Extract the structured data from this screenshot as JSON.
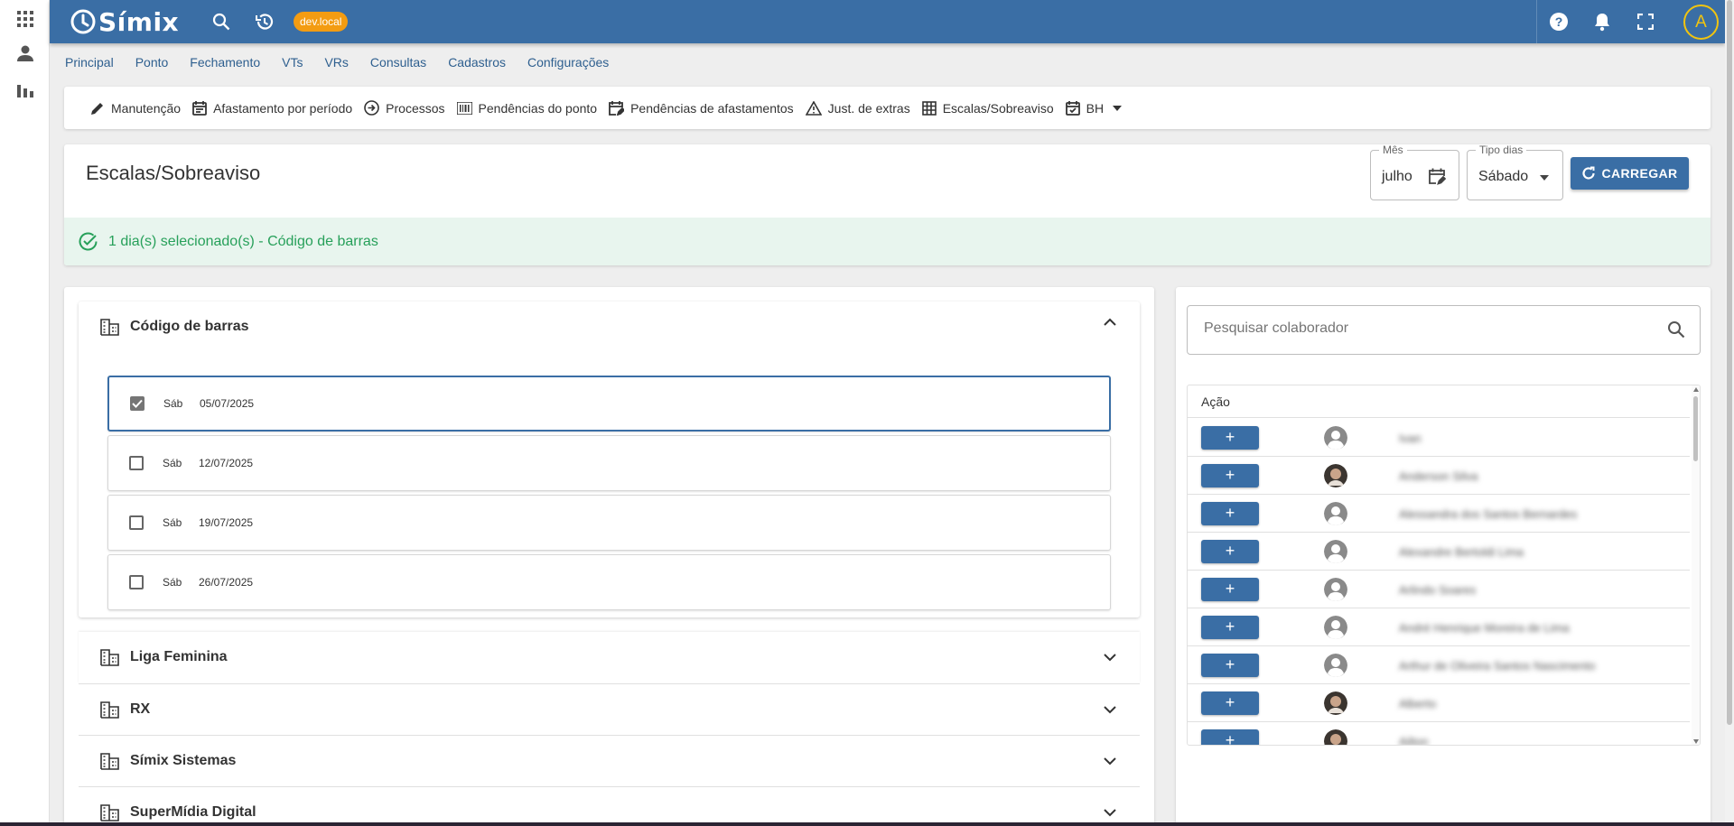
{
  "app": {
    "name": "Símix",
    "env_badge": "dev.local",
    "user_initial": "A"
  },
  "main_nav": [
    "Principal",
    "Ponto",
    "Fechamento",
    "VTs",
    "VRs",
    "Consultas",
    "Cadastros",
    "Configurações"
  ],
  "sub_nav": [
    {
      "label": "Manutenção",
      "icon": "pencil-icon"
    },
    {
      "label": "Afastamento por período",
      "icon": "calendar-icon"
    },
    {
      "label": "Processos",
      "icon": "arrow-circle-icon"
    },
    {
      "label": "Pendências do ponto",
      "icon": "barcode-icon"
    },
    {
      "label": "Pendências de afastamentos",
      "icon": "calendar-edit-icon"
    },
    {
      "label": "Just. de extras",
      "icon": "warning-icon"
    },
    {
      "label": "Escalas/Sobreaviso",
      "icon": "table-icon"
    },
    {
      "label": "BH",
      "icon": "calendar-check-icon"
    }
  ],
  "page": {
    "title": "Escalas/Sobreaviso",
    "mes": {
      "label": "Mês",
      "value": "julho"
    },
    "tipo_dias": {
      "label": "Tipo dias",
      "value": "Sábado"
    },
    "carregar_label": "CARREGAR",
    "banner": "1 dia(s) selecionado(s) - Código de barras"
  },
  "groups": {
    "open": {
      "title": "Código de barras",
      "days": [
        {
          "day": "Sáb",
          "date": "05/07/2025",
          "checked": true
        },
        {
          "day": "Sáb",
          "date": "12/07/2025",
          "checked": false
        },
        {
          "day": "Sáb",
          "date": "19/07/2025",
          "checked": false
        },
        {
          "day": "Sáb",
          "date": "26/07/2025",
          "checked": false
        }
      ]
    },
    "closed": [
      "Liga Feminina",
      "RX",
      "Símix Sistemas",
      "SuperMídia Digital"
    ]
  },
  "collaborators": {
    "search_placeholder": "Pesquisar colaborador",
    "column_header": "Ação",
    "add_label": "+",
    "rows": [
      {
        "name": "Ivan",
        "photo": false
      },
      {
        "name": "Anderson Silva",
        "photo": true
      },
      {
        "name": "Alessandra dos Santos Bernardes",
        "photo": false
      },
      {
        "name": "Alexandre Bertoldi Lima",
        "photo": false
      },
      {
        "name": "Arlindo Soares",
        "photo": false
      },
      {
        "name": "André Henrique Moreira de Lima",
        "photo": false
      },
      {
        "name": "Arthur de Oliveira Santos Nascimento",
        "photo": false
      },
      {
        "name": "Alberto",
        "photo": true
      },
      {
        "name": "Ailton",
        "photo": true
      }
    ]
  },
  "colors": {
    "primary": "#3a6ea5",
    "success": "#27a05a",
    "badge": "#f39c12",
    "avatar_ring": "#f1c40f"
  }
}
